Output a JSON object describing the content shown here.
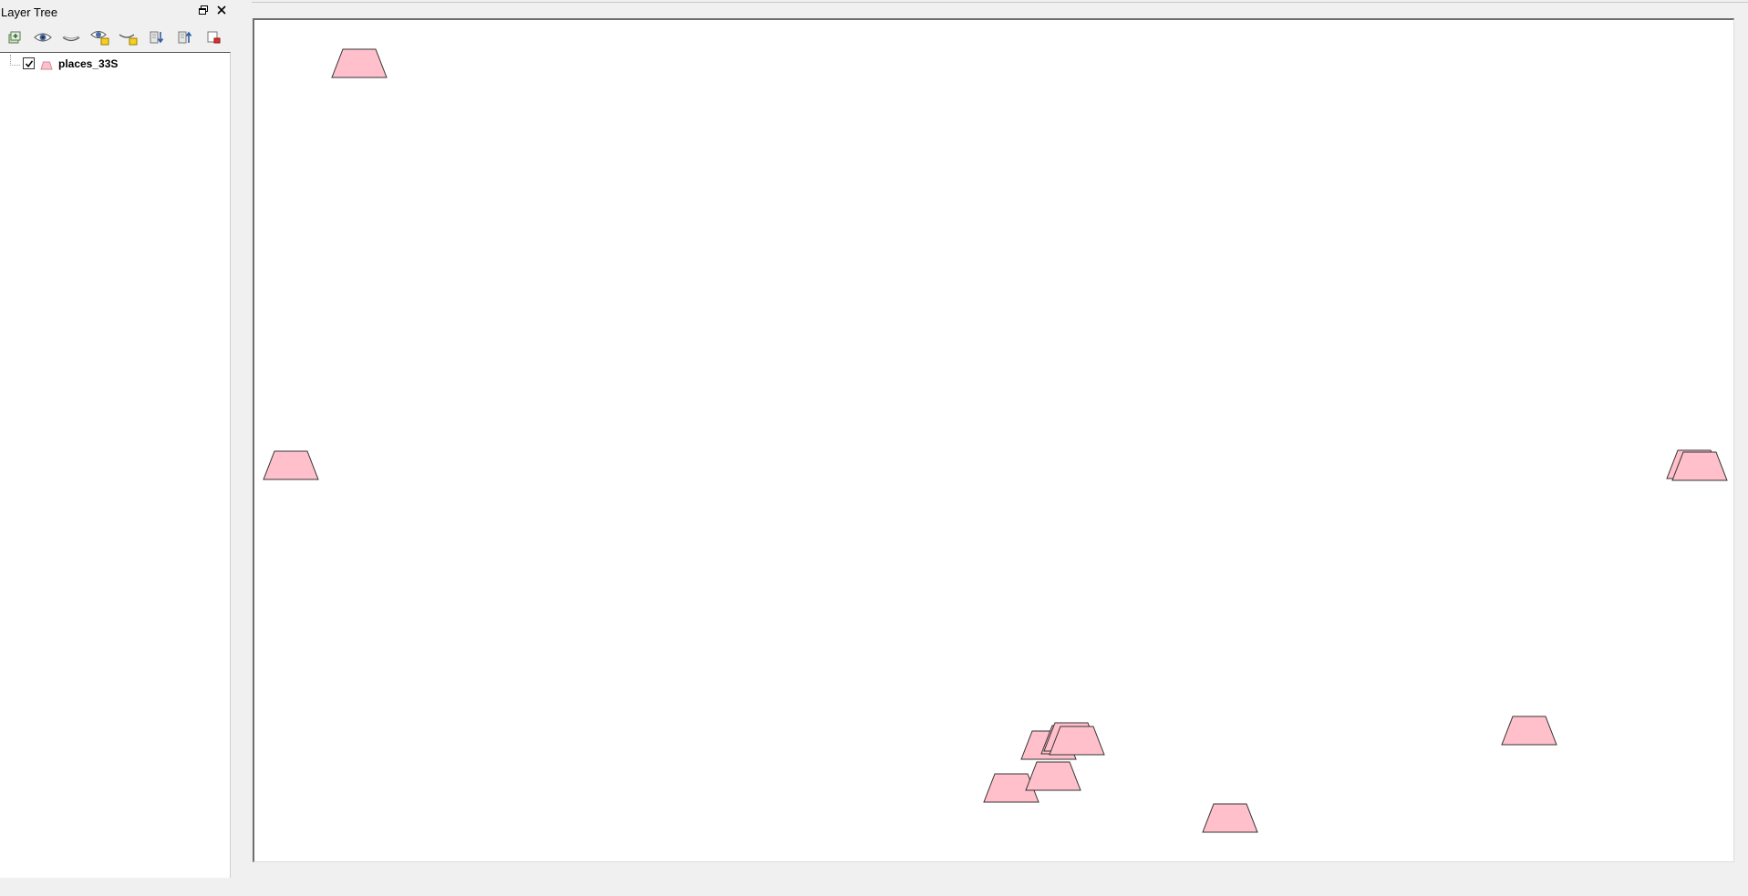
{
  "dock": {
    "title": "Layer Tree",
    "float_icon": "dock-float-icon",
    "close_icon": "dock-close-icon",
    "toolbar": [
      {
        "name": "add-group-icon"
      },
      {
        "name": "show-all-layers-icon"
      },
      {
        "name": "hide-all-layers-icon"
      },
      {
        "name": "show-selected-layers-icon"
      },
      {
        "name": "hide-selected-layers-icon"
      },
      {
        "name": "expand-all-icon"
      },
      {
        "name": "collapse-all-icon"
      },
      {
        "name": "remove-layer-icon"
      }
    ]
  },
  "layers": [
    {
      "name": "places_33S",
      "visible": true,
      "symbol": "pink-trapezoid"
    }
  ],
  "map": {
    "symbol_fill": "#ffc0cb",
    "symbol_stroke": "#333333",
    "feature_count": 14
  }
}
